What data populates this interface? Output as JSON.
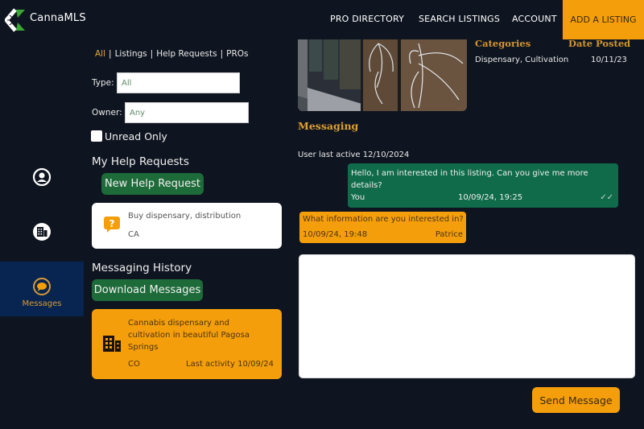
{
  "header": {
    "brand": "CannaMLS",
    "nav": [
      "PRO DIRECTORY",
      "SEARCH LISTINGS",
      "ACCOUNT"
    ],
    "add_listing": "ADD A LISTING"
  },
  "rail": {
    "items": [
      {
        "icon": "user-circle-icon",
        "label": ""
      },
      {
        "icon": "building-icon",
        "label": ""
      },
      {
        "icon": "chat-bubble-icon",
        "label": "Messages",
        "active": true
      }
    ]
  },
  "filters": {
    "tabs": [
      "All",
      "Listings",
      "Help Requests",
      "PROs"
    ],
    "active_tab": "All",
    "type_label": "Type:",
    "type_value": "All",
    "owner_label": "Owner:",
    "owner_value": "Any",
    "unread_label": "Unread Only",
    "unread_checked": false
  },
  "help_requests": {
    "title": "My Help Requests",
    "new_button": "New Help Request",
    "items": [
      {
        "icon": "question-bubble-icon",
        "title": "Buy dispensary, distribution",
        "state": "CA"
      }
    ]
  },
  "history": {
    "title": "Messaging History",
    "download_button": "Download Messages",
    "items": [
      {
        "icon": "building-icon",
        "title": "Cannabis dispensary and cultivation in beautiful Pagosa Springs",
        "state": "CO",
        "last_activity": "Last activity 10/09/24"
      }
    ]
  },
  "listing": {
    "categories_label": "Categories",
    "categories_value": "Dispensary, Cultivation",
    "date_label": "Date Posted",
    "date_value": "10/11/23"
  },
  "messaging": {
    "title": "Messaging",
    "last_active": "User last active 12/10/2024",
    "messages": [
      {
        "direction": "out",
        "text": "Hello, I am interested in this listing. Can you give me more details?",
        "sender": "You",
        "time": "10/09/24, 19:25",
        "status": "read"
      },
      {
        "direction": "in",
        "text": "What information are you interested in?",
        "sender": "Patrice",
        "time": "10/09/24, 19:48"
      }
    ],
    "input_value": "",
    "send_button": "Send Message"
  },
  "colors": {
    "background": "#0f1520",
    "accent_orange": "#f59e0b",
    "green_button": "#1e6b3a",
    "outgoing_bubble": "#0f6b4a",
    "rail_active": "#072550"
  }
}
